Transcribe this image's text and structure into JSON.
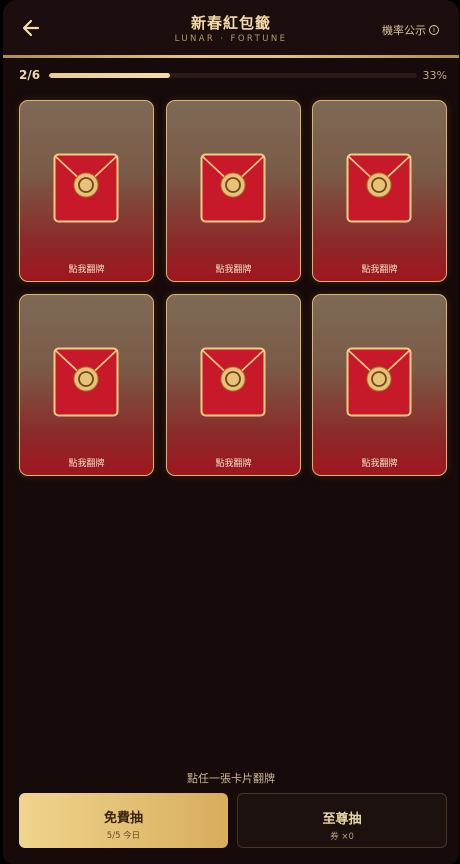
{
  "header": {
    "title": "新春紅包籤",
    "subtitle": "LUNAR · FORTUNE",
    "odds_label": "機率公示",
    "info_icon": "ⓘ"
  },
  "progress": {
    "count_text": "2/6",
    "percent_text": "33%",
    "fraction": 0.33
  },
  "cards": [
    {
      "label": "點我翻牌",
      "icon": "red-envelope-icon"
    },
    {
      "label": "點我翻牌",
      "icon": "red-envelope-icon"
    },
    {
      "label": "點我翻牌",
      "icon": "red-envelope-icon"
    },
    {
      "label": "點我翻牌",
      "icon": "red-envelope-icon"
    },
    {
      "label": "點我翻牌",
      "icon": "red-envelope-icon"
    },
    {
      "label": "點我翻牌",
      "icon": "red-envelope-icon"
    }
  ],
  "hint": "點任一張卡片翻牌",
  "buttons": {
    "free": {
      "label": "免費抽",
      "sub": "5/5 今日"
    },
    "premium": {
      "label": "至尊抽",
      "sub": "券 ×0"
    }
  },
  "colors": {
    "background": "#160a0b",
    "gold": "#e3c381",
    "envelope_red": "#c8192b"
  }
}
